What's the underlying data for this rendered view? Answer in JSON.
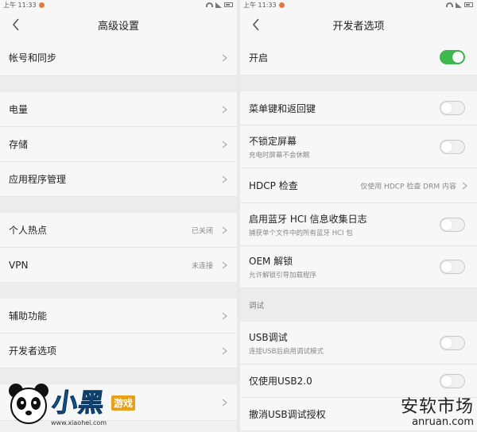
{
  "status_time": "上午 11:33",
  "left": {
    "title": "高级设置",
    "rows": {
      "account": {
        "label": "帐号和同步"
      },
      "battery": {
        "label": "电量"
      },
      "storage": {
        "label": "存储"
      },
      "apps": {
        "label": "应用程序管理"
      },
      "hotspot": {
        "label": "个人热点",
        "value": "已关闭"
      },
      "vpn": {
        "label": "VPN",
        "value": "未连接"
      },
      "accessibility": {
        "label": "辅助功能"
      },
      "developer": {
        "label": "开发者选项"
      }
    }
  },
  "right": {
    "title": "开发者选项",
    "rows": {
      "enable": {
        "label": "开启",
        "on": true
      },
      "menu_keys": {
        "label": "菜单键和返回键",
        "on": false
      },
      "stay_awake": {
        "label": "不锁定屏幕",
        "sub": "充电时屏幕不会休眠",
        "on": false
      },
      "hdcp": {
        "label": "HDCP 检查",
        "value": "仅使用 HDCP 检查 DRM 内容"
      },
      "bt_hci": {
        "label": "启用蓝牙 HCI 信息收集日志",
        "sub": "捕获单个文件中的所有蓝牙 HCI 包",
        "on": false
      },
      "oem_unlock": {
        "label": "OEM 解锁",
        "sub": "允许解锁引导加载程序",
        "on": false
      },
      "debug_section": "调试",
      "usb_debug": {
        "label": "USB调试",
        "sub": "连接USB后启用调试模式",
        "on": false
      },
      "usb2": {
        "label": "仅使用USB2.0",
        "on": false
      },
      "revoke": {
        "label": "撤消USB调试授权"
      }
    }
  },
  "watermarks": {
    "logo_brand": "小黑",
    "logo_tag": "游戏",
    "logo_site": "www.xiaohei.com",
    "market_main": "安软市场",
    "market_sub": "anruan.com"
  },
  "colors": {
    "toggle_on": "#3eb74c",
    "notif_dot": "#e07a3a"
  }
}
